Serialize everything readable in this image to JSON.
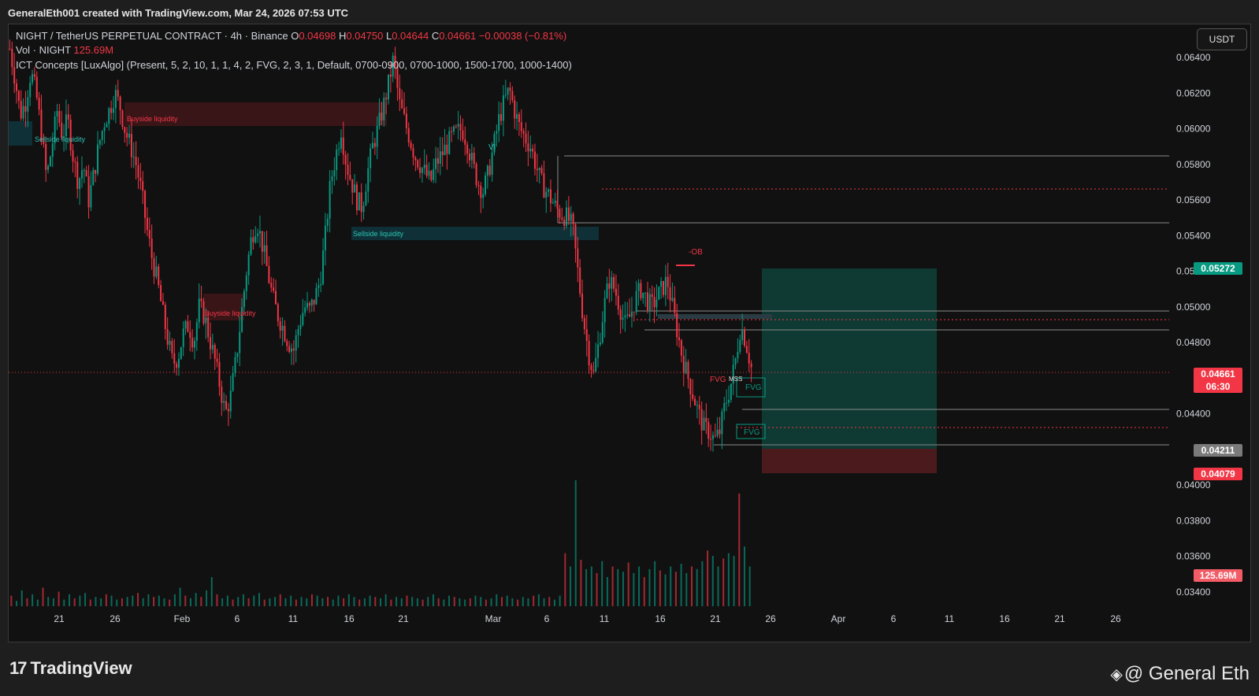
{
  "header": {
    "attribution": "GeneralEth001 created with TradingView.com, Mar 24, 2026 07:53 UTC"
  },
  "legend": {
    "symbol": "NIGHT / TetherUS PERPETUAL CONTRACT · 4h · Binance",
    "o_label": "O",
    "o_value": "0.04698",
    "h_label": "H",
    "h_value": "0.04750",
    "l_label": "L",
    "l_value": "0.04644",
    "c_label": "C",
    "c_value": "0.04661",
    "change": "−0.00038 (−0.81%)",
    "vol_label": "Vol · NIGHT",
    "vol_value": "125.69M",
    "indicator": "ICT Concepts [LuxAlgo] (Present, 5, 2, 10, 1, 1, 4, 2, FVG, 2, 3, 1, Default, 0700-0900, 0700-1000, 1500-1700, 1000-1400)"
  },
  "currency_button": "USDT",
  "price_axis": {
    "ticks": [
      "0.06400",
      "0.06200",
      "0.06000",
      "0.05800",
      "0.05600",
      "0.05400",
      "0.05200",
      "0.05000",
      "0.04800",
      "0.04400",
      "0.04000",
      "0.03800",
      "0.03600",
      "0.03400"
    ]
  },
  "time_axis": {
    "ticks": [
      "21",
      "26",
      "Feb",
      "6",
      "11",
      "16",
      "21",
      "Mar",
      "6",
      "11",
      "16",
      "21",
      "26",
      "Apr",
      "6",
      "11",
      "16",
      "21",
      "26"
    ]
  },
  "badges": {
    "target": "0.05272",
    "current": "0.04661",
    "countdown": "06:30",
    "entry": "0.04211",
    "stop": "0.04079",
    "volume": "125.69M"
  },
  "annotations": {
    "buyside_1": "Buyside liquidity",
    "sellside_1": "Sellside liquidity",
    "sellside_2": "Sellside liquidity",
    "buyside_2": "Buyside liquidity",
    "ob": "-OB",
    "fvg_1": "FVG",
    "mss": "MSS",
    "fvg_2": "FVG",
    "fvg_3": "FVG",
    "vi": "VI"
  },
  "branding": {
    "logo_text": "TradingView",
    "author": "@ General Eth"
  },
  "colors": {
    "bull": "#089981",
    "bear": "#f23645",
    "target_zone": "#0f3a33",
    "stop_zone": "#4a1a1c"
  },
  "chart_data": {
    "type": "candlestick",
    "symbol": "NIGHT/USDT",
    "timeframe": "4h",
    "ylim": [
      0.0332,
      0.0659
    ],
    "current_price": 0.04661,
    "position": {
      "entry": 0.04211,
      "target": 0.05272,
      "stop": 0.04079
    },
    "close_path": [
      0.0645,
      0.0628,
      0.0608,
      0.0615,
      0.0632,
      0.062,
      0.0598,
      0.0572,
      0.059,
      0.061,
      0.0596,
      0.0605,
      0.0585,
      0.057,
      0.058,
      0.056,
      0.0575,
      0.0592,
      0.0604,
      0.0611,
      0.062,
      0.0612,
      0.0598,
      0.059,
      0.058,
      0.0565,
      0.0545,
      0.0528,
      0.0515,
      0.0498,
      0.0482,
      0.0468,
      0.0472,
      0.0485,
      0.049,
      0.048,
      0.05,
      0.0495,
      0.0482,
      0.047,
      0.0455,
      0.044,
      0.045,
      0.047,
      0.0495,
      0.052,
      0.054,
      0.0548,
      0.0535,
      0.052,
      0.0505,
      0.0495,
      0.0488,
      0.048,
      0.0476,
      0.049,
      0.05,
      0.0498,
      0.0505,
      0.0515,
      0.054,
      0.057,
      0.0585,
      0.06,
      0.058,
      0.057,
      0.056,
      0.0556,
      0.0575,
      0.059,
      0.06,
      0.0612,
      0.0625,
      0.064,
      0.0615,
      0.0605,
      0.0595,
      0.0585,
      0.058,
      0.0575,
      0.057,
      0.058,
      0.0585,
      0.059,
      0.0595,
      0.0598,
      0.06,
      0.0592,
      0.058,
      0.057,
      0.0565,
      0.0575,
      0.059,
      0.0605,
      0.0615,
      0.0622,
      0.061,
      0.06,
      0.0595,
      0.059,
      0.058,
      0.057,
      0.0565,
      0.056,
      0.0555,
      0.0552,
      0.055,
      0.0545,
      0.052,
      0.0495,
      0.0475,
      0.0462,
      0.048,
      0.05,
      0.0515,
      0.051,
      0.05,
      0.049,
      0.0495,
      0.0505,
      0.051,
      0.0505,
      0.05,
      0.0505,
      0.051,
      0.0515,
      0.05,
      0.0485,
      0.047,
      0.046,
      0.045,
      0.044,
      0.0432,
      0.043,
      0.0425,
      0.043,
      0.0445,
      0.0455,
      0.047,
      0.049,
      0.048,
      0.0466
    ],
    "volume_path": [
      8,
      4,
      12,
      6,
      9,
      5,
      14,
      7,
      6,
      11,
      5,
      9,
      6,
      8,
      10,
      5,
      7,
      6,
      9,
      8,
      5,
      6,
      7,
      8,
      10,
      6,
      9,
      7,
      8,
      6,
      5,
      9,
      14,
      8,
      6,
      10,
      7,
      12,
      22,
      9,
      6,
      8,
      5,
      7,
      9,
      6,
      8,
      10,
      5,
      6,
      7,
      9,
      6,
      8,
      5,
      7,
      6,
      9,
      8,
      6,
      7,
      5,
      8,
      6,
      9,
      7,
      5,
      6,
      8,
      7,
      6,
      9,
      5,
      7,
      6,
      8,
      7,
      6,
      5,
      7,
      9,
      6,
      5,
      8,
      7,
      6,
      5,
      6,
      8,
      7,
      5,
      6,
      9,
      7,
      8,
      6,
      5,
      7,
      6,
      8,
      9,
      6,
      7,
      5,
      8,
      40,
      30,
      95,
      35,
      28,
      30,
      25,
      34,
      22,
      30,
      28,
      26,
      33,
      25,
      30,
      22,
      28,
      34,
      27,
      24,
      30,
      26,
      32,
      25,
      30,
      28,
      34,
      42,
      38,
      30,
      36,
      40,
      38,
      85,
      45,
      30
    ]
  }
}
